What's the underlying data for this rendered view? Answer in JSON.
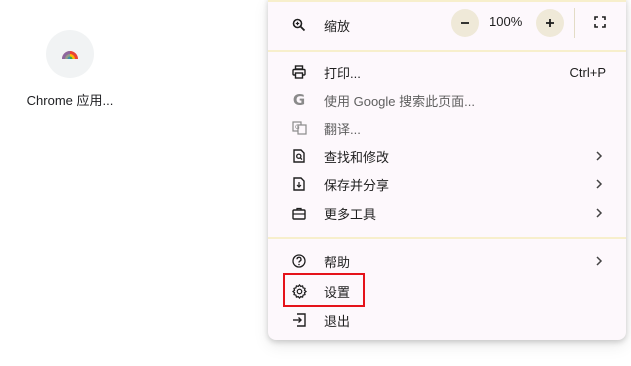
{
  "shortcut": {
    "label": "Chrome 应用..."
  },
  "zoom": {
    "label": "缩放",
    "value": "100%",
    "minus": "−",
    "plus": "+"
  },
  "menu": {
    "print": {
      "label": "打印...",
      "key": "Ctrl+P"
    },
    "google_search_page": {
      "label": "使用 Google 搜索此页面..."
    },
    "translate": {
      "label": "翻译..."
    },
    "find_edit": {
      "label": "查找和修改"
    },
    "save_share": {
      "label": "保存并分享"
    },
    "more_tools": {
      "label": "更多工具"
    },
    "help": {
      "label": "帮助"
    },
    "settings": {
      "label": "设置"
    },
    "exit": {
      "label": "退出"
    }
  },
  "colors": {
    "highlight": "#e5131a",
    "menu_bg": "#fdf8fc",
    "separator": "#f7efcc"
  }
}
